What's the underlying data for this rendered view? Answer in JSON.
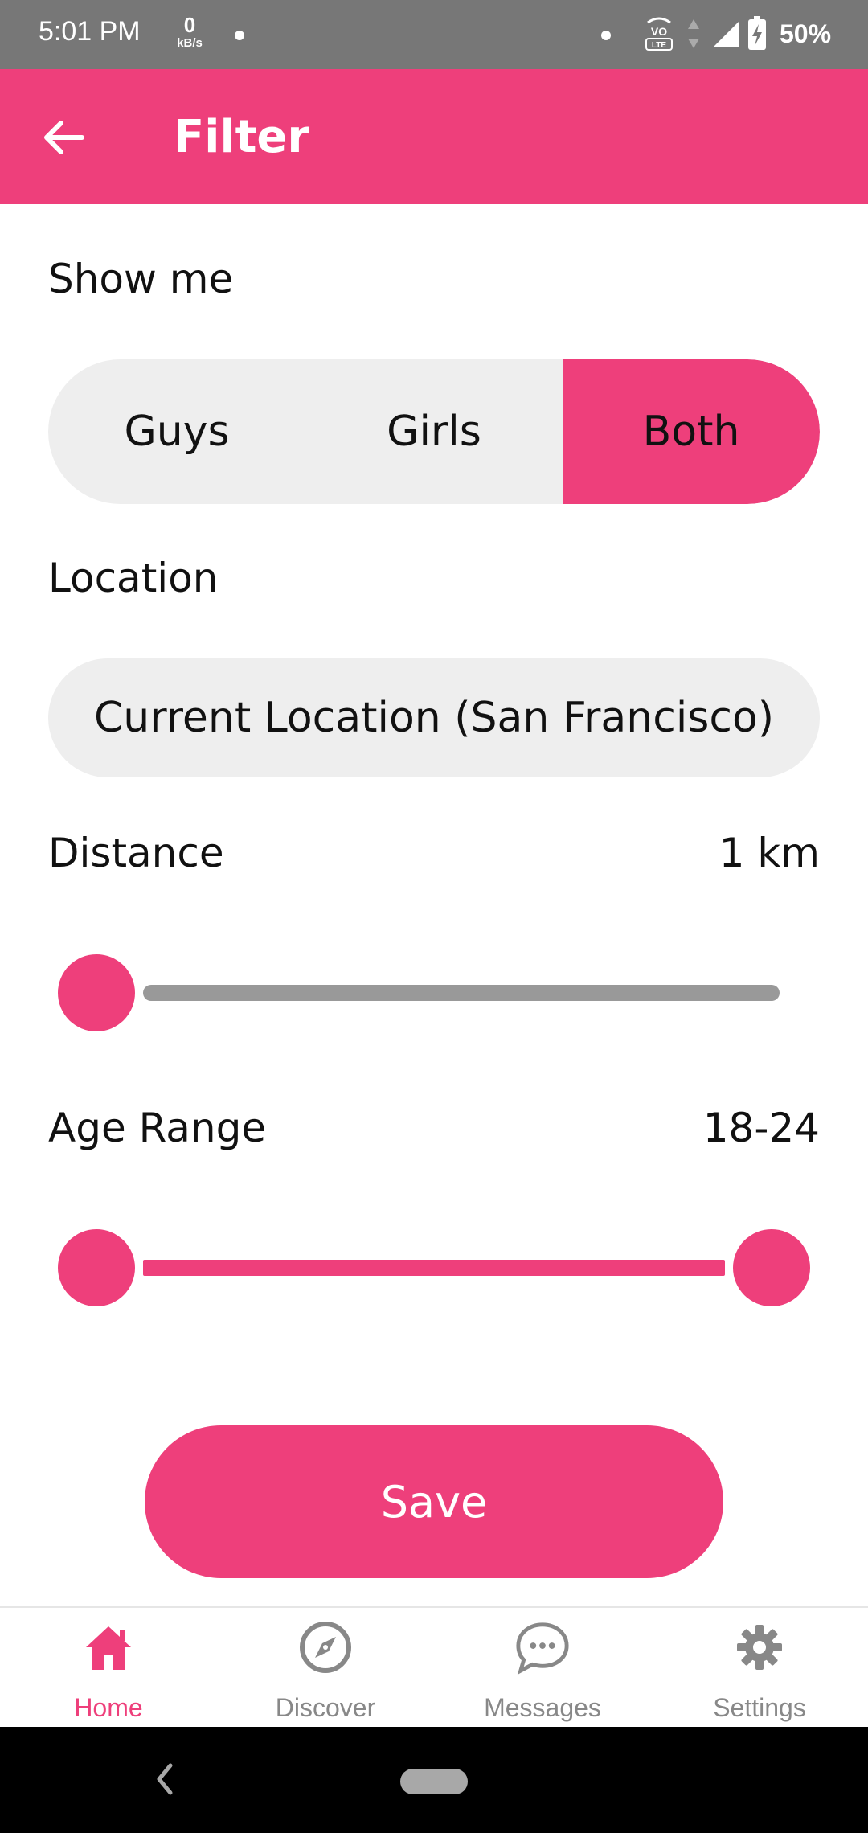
{
  "status_bar": {
    "time": "5:01 PM",
    "net_speed_value": "0",
    "net_speed_unit": "kB/s",
    "battery_text": "50%",
    "icons": [
      "notification-dot-icon",
      "volte-icon",
      "data-arrows-icon",
      "signal-icon",
      "battery-charging-icon"
    ]
  },
  "app_bar": {
    "title": "Filter",
    "back_icon": "arrow-left-icon"
  },
  "filter": {
    "show_me": {
      "label": "Show me",
      "options": [
        "Guys",
        "Girls",
        "Both"
      ],
      "selected": "Both"
    },
    "location": {
      "label": "Location",
      "value": "Current Location (San Francisco)"
    },
    "distance": {
      "label": "Distance",
      "value_text": "1 km",
      "slider_fraction": 0.0
    },
    "age_range": {
      "label": "Age Range",
      "value_text": "18-24",
      "min_fraction": 0.0,
      "max_fraction": 1.0
    }
  },
  "save_label": "Save",
  "bottom_nav": {
    "items": [
      {
        "label": "Home",
        "icon": "home-icon",
        "active": true
      },
      {
        "label": "Discover",
        "icon": "compass-icon",
        "active": false
      },
      {
        "label": "Messages",
        "icon": "chat-bubble-icon",
        "active": false
      },
      {
        "label": "Settings",
        "icon": "gear-icon",
        "active": false
      }
    ]
  },
  "colors": {
    "accent": "#ee3f7b",
    "status_bar": "#777777",
    "field_bg": "#eeeeee",
    "track_inactive": "#999999",
    "nav_inactive": "#888888"
  }
}
